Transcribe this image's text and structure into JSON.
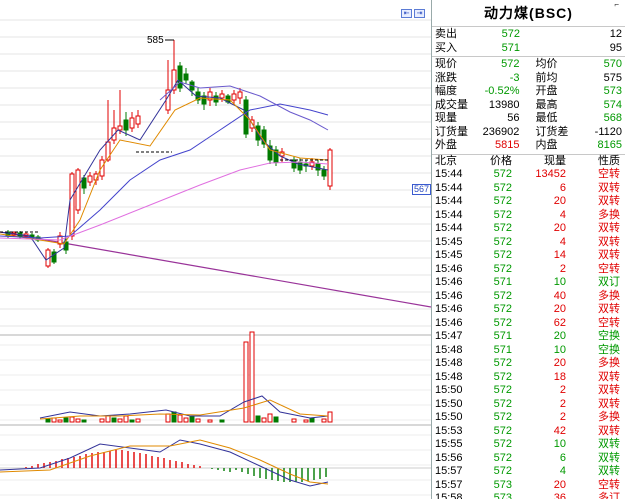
{
  "panel": {
    "title": "动力煤(BSC)",
    "corner_mark": "⌐"
  },
  "bid_ask": [
    {
      "label": "卖出",
      "price": "572",
      "qty": "12"
    },
    {
      "label": "买入",
      "price": "571",
      "qty": "95"
    }
  ],
  "stats": [
    {
      "l1": "现价",
      "v1": "572",
      "c1": "green",
      "l2": "均价",
      "v2": "570",
      "c2": "green"
    },
    {
      "l1": "涨跌",
      "v1": "-3",
      "c1": "green",
      "l2": "前均",
      "v2": "575",
      "c2": "black"
    },
    {
      "l1": "幅度",
      "v1": "-0.52%",
      "c1": "green",
      "l2": "开盘",
      "v2": "573",
      "c2": "green"
    },
    {
      "l1": "成交量",
      "v1": "13980",
      "c1": "black",
      "l2": "最高",
      "v2": "574",
      "c2": "green"
    },
    {
      "l1": "现量",
      "v1": "56",
      "c1": "black",
      "l2": "最低",
      "v2": "568",
      "c2": "green"
    },
    {
      "l1": "订货量",
      "v1": "236902",
      "c1": "black",
      "l2": "订货差",
      "v2": "-1120",
      "c2": "black"
    },
    {
      "l1": "外盘",
      "v1": "5815",
      "c1": "red",
      "l2": "内盘",
      "v2": "8165",
      "c2": "green"
    }
  ],
  "trades_header": {
    "time": "北京",
    "price": "价格",
    "qty": "现量",
    "nature": "性质"
  },
  "trades": [
    {
      "time": "15:44",
      "price": "572",
      "qty": "13452",
      "qc": "red",
      "nature": "空转",
      "nc": "red"
    },
    {
      "time": "15:44",
      "price": "572",
      "qty": "6",
      "qc": "red",
      "nature": "双转",
      "nc": "red"
    },
    {
      "time": "15:44",
      "price": "572",
      "qty": "20",
      "qc": "red",
      "nature": "双转",
      "nc": "red"
    },
    {
      "time": "15:44",
      "price": "572",
      "qty": "4",
      "qc": "red",
      "nature": "多换",
      "nc": "red"
    },
    {
      "time": "15:44",
      "price": "572",
      "qty": "20",
      "qc": "red",
      "nature": "双转",
      "nc": "red"
    },
    {
      "time": "15:45",
      "price": "572",
      "qty": "4",
      "qc": "red",
      "nature": "双转",
      "nc": "red"
    },
    {
      "time": "15:45",
      "price": "572",
      "qty": "14",
      "qc": "red",
      "nature": "双转",
      "nc": "red"
    },
    {
      "time": "15:46",
      "price": "572",
      "qty": "2",
      "qc": "red",
      "nature": "空转",
      "nc": "red"
    },
    {
      "time": "15:46",
      "price": "571",
      "qty": "10",
      "qc": "green",
      "nature": "双订",
      "nc": "green"
    },
    {
      "time": "15:46",
      "price": "572",
      "qty": "40",
      "qc": "red",
      "nature": "多换",
      "nc": "red"
    },
    {
      "time": "15:46",
      "price": "572",
      "qty": "20",
      "qc": "red",
      "nature": "双转",
      "nc": "red"
    },
    {
      "time": "15:46",
      "price": "572",
      "qty": "62",
      "qc": "red",
      "nature": "空转",
      "nc": "red"
    },
    {
      "time": "15:47",
      "price": "571",
      "qty": "20",
      "qc": "green",
      "nature": "空换",
      "nc": "green"
    },
    {
      "time": "15:48",
      "price": "571",
      "qty": "10",
      "qc": "green",
      "nature": "空换",
      "nc": "green"
    },
    {
      "time": "15:48",
      "price": "572",
      "qty": "20",
      "qc": "red",
      "nature": "多换",
      "nc": "red"
    },
    {
      "time": "15:48",
      "price": "572",
      "qty": "18",
      "qc": "red",
      "nature": "双转",
      "nc": "red"
    },
    {
      "time": "15:50",
      "price": "572",
      "qty": "2",
      "qc": "red",
      "nature": "双转",
      "nc": "red"
    },
    {
      "time": "15:50",
      "price": "572",
      "qty": "2",
      "qc": "red",
      "nature": "双转",
      "nc": "red"
    },
    {
      "time": "15:50",
      "price": "572",
      "qty": "2",
      "qc": "red",
      "nature": "多换",
      "nc": "red"
    },
    {
      "time": "15:53",
      "price": "572",
      "qty": "42",
      "qc": "red",
      "nature": "双转",
      "nc": "red"
    },
    {
      "time": "15:55",
      "price": "572",
      "qty": "10",
      "qc": "green",
      "nature": "双转",
      "nc": "green"
    },
    {
      "time": "15:56",
      "price": "572",
      "qty": "6",
      "qc": "green",
      "nature": "双转",
      "nc": "green"
    },
    {
      "time": "15:57",
      "price": "572",
      "qty": "4",
      "qc": "green",
      "nature": "双转",
      "nc": "green"
    },
    {
      "time": "15:57",
      "price": "573",
      "qty": "20",
      "qc": "red",
      "nature": "空转",
      "nc": "red"
    },
    {
      "time": "15:58",
      "price": "573",
      "qty": "36",
      "qc": "red",
      "nature": "多订",
      "nc": "red"
    }
  ],
  "chart": {
    "high_label": "585",
    "last_price_tag": "567",
    "colors": {
      "up": "#e00000",
      "down": "#007a00",
      "ma1": "#333399",
      "ma2": "#e08a00",
      "ma3": "#4444cc",
      "ma4": "#e070e0",
      "trend": "#993399"
    }
  }
}
